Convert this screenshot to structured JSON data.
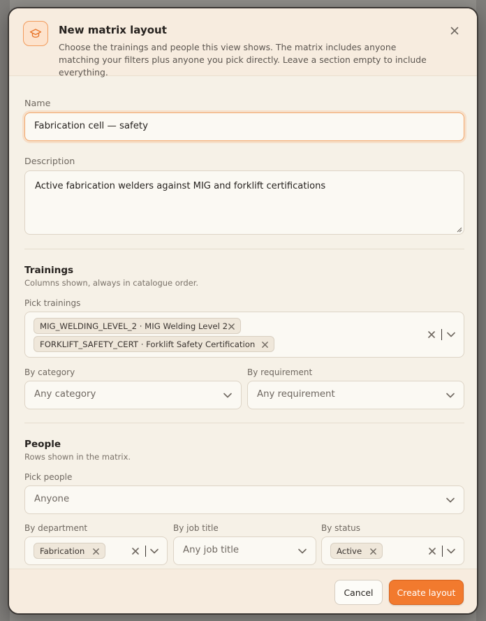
{
  "dialog": {
    "title": "New matrix layout",
    "subtitle": "Choose the trainings and people this view shows. The matrix includes anyone matching your filters plus anyone you pick directly. Leave a section empty to include everything.",
    "header_icon": "graduation-cap-icon",
    "close_icon": "close-icon"
  },
  "name": {
    "label": "Name",
    "value": "Fabrication cell — safety"
  },
  "description": {
    "label": "Description",
    "value": "Active fabrication welders against MIG and forklift certifications"
  },
  "trainings": {
    "title": "Trainings",
    "subtitle": "Columns shown, always in catalogue order.",
    "pick_label": "Pick trainings",
    "picked": [
      "MIG_WELDING_LEVEL_2 · MIG Welding Level 2",
      "FORKLIFT_SAFETY_CERT · Forklift Safety Certification"
    ],
    "category_label": "By category",
    "category_placeholder": "Any category",
    "requirement_label": "By requirement",
    "requirement_placeholder": "Any requirement"
  },
  "people": {
    "title": "People",
    "subtitle": "Rows shown in the matrix.",
    "pick_label": "Pick people",
    "pick_value": "Anyone",
    "department_label": "By department",
    "department_chips": [
      "Fabrication"
    ],
    "job_title_label": "By job title",
    "job_title_placeholder": "Any job title",
    "status_label": "By status",
    "status_chips": [
      "Active"
    ]
  },
  "footer": {
    "cancel_label": "Cancel",
    "create_label": "Create layout"
  },
  "colors": {
    "accent": "#f27a2e",
    "panel": "#f6f1e7",
    "header": "#f7ecdf",
    "text": "#26221f"
  }
}
